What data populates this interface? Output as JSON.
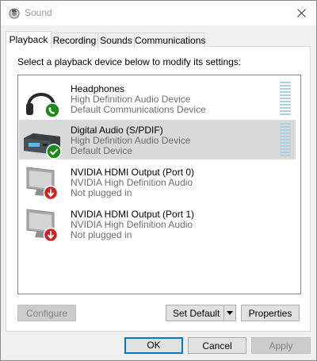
{
  "window": {
    "title": "Sound",
    "close_icon": "close-icon"
  },
  "tabs": [
    {
      "label": "Playback"
    },
    {
      "label": "Recording"
    },
    {
      "label": "Sounds"
    },
    {
      "label": "Communications"
    }
  ],
  "prompt": "Select a playback device below to modify its settings:",
  "devices": [
    {
      "name": "Headphones",
      "line2": "High Definition Audio Device",
      "line3": "Default Communications Device",
      "icon": "headphones-icon",
      "badge": "phone-badge-icon",
      "status_color": "#1e8a1e"
    },
    {
      "name": "Digital Audio (S/PDIF)",
      "line2": "High Definition Audio Device",
      "line3": "Default Device",
      "icon": "spdif-receiver-icon",
      "badge": "checkmark-badge-icon",
      "status_color": "#1e8a1e"
    },
    {
      "name": "NVIDIA HDMI Output (Port 0)",
      "line2": "NVIDIA High Definition Audio",
      "line3": "Not plugged in",
      "icon": "monitor-icon",
      "badge": "down-arrow-badge-icon",
      "status_color": "#d32020"
    },
    {
      "name": "NVIDIA HDMI Output (Port 1)",
      "line2": "NVIDIA High Definition Audio",
      "line3": "Not plugged in",
      "icon": "monitor-icon",
      "badge": "down-arrow-badge-icon",
      "status_color": "#d32020"
    }
  ],
  "buttons": {
    "configure": "Configure",
    "set_default": "Set Default",
    "properties": "Properties",
    "ok": "OK",
    "cancel": "Cancel",
    "apply": "Apply"
  }
}
